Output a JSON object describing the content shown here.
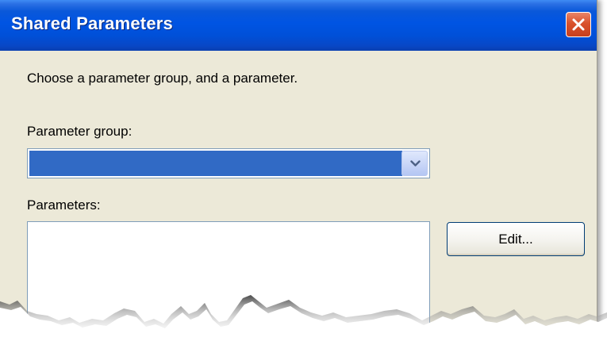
{
  "window": {
    "title": "Shared Parameters",
    "close_icon": "close-icon",
    "titlebar_color": "#0054e3",
    "close_color": "#d9512b",
    "body_color": "#ece9d8"
  },
  "dialog": {
    "instruction": "Choose a parameter group, and a parameter.",
    "parameter_group": {
      "label": "Parameter group:",
      "selected_value": "",
      "selection_color": "#316ac5",
      "dropdown_icon": "chevron-down-icon"
    },
    "parameters": {
      "label": "Parameters:",
      "items": []
    },
    "edit_button_label": "Edit..."
  }
}
